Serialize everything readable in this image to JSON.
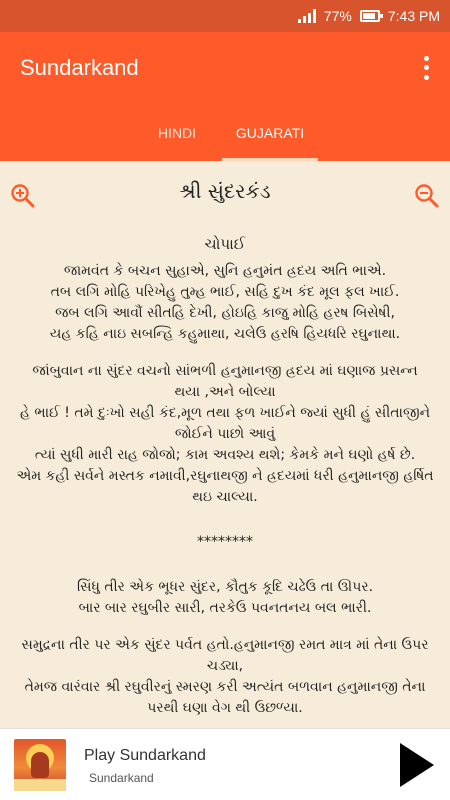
{
  "status_bar": {
    "battery": "77%",
    "time": "7:43 PM"
  },
  "app_bar": {
    "title": "Sundarkand"
  },
  "tabs": [
    {
      "label": "HINDI",
      "active": false
    },
    {
      "label": "GUJARATI",
      "active": true
    }
  ],
  "content": {
    "title": "શ્રી સુંદરકંડ",
    "heading": "ચોપાઈ",
    "lines": [
      "જામવંત કે બચન સુહાએ, સુનિ હનુમંત હ્રદય અતિ ભાએ.",
      "તબ લગિ મોહિ પરિખેહુ તુમ્હ ભાઈ, સહિ દુખ કંદ મૂલ ફલ ખાઈ.",
      "જબ લગિ આવૌં સીતહિ દેખી, હોઇહિ કાજુ મોહિ હરષ બિસેષી,",
      "યહ કહિ નાઇ સબન્હિ કહુમાથા, ચલેઉ હરષિ હિયધરિ રઘુનાથા.",
      "",
      "જાંબુવાન ના સુંદર વચનો સાંભળી હનુમાનજી હ્રદય માં ઘણાજ પ્રસન્ન",
      "થયા ,અને બોલ્યા",
      "હે ભાઈ ! તમે દુઃખો સહી કંદ,મૂળ તથા ફળ ખાઈને જ્યાં સુધી હું સીતાજીને",
      "જોઈને પાછો આવું",
      "ત્યાં સુધી મારી રાહ જોજો; કામ અવશ્ય થશે; કેમકે મને ઘણો હર્ષ છે.",
      "એમ કહી સર્વને મસ્તક નમાવી,રઘુનાથજી ને હ્રદયમાં ધરી હનુમાનજી હર્ષિત",
      "થઇ ચાલ્યા.",
      "",
      "********",
      "",
      "સિંધુ તીર એક ભૂધર સુંદર, કૌતુક કૂદિ ચઢેઉ તા ઊપર.",
      "બાર બાર રઘુબીર સારી, તરકેઉ પવનતનય બલ ભારી.",
      "",
      "સમુદ્રના તીર પર એક સુંદર પર્વત હતો.હનુમાનજી રમત માત્ર માં તેના ઉપર",
      "ચડ્યા,",
      "તેમજ વારંવાર શ્રી રઘુવીરનું સ્મરણ કરી અત્યંત બળવાન હનુમાનજી તેના",
      "પરથી ઘણા વેગ થી ઉછળ્યા."
    ]
  },
  "player": {
    "title": "Play Sundarkand",
    "subtitle": "Sundarkand"
  },
  "colors": {
    "status_bar": "#d8542c",
    "app_bar": "#ff5a2a",
    "content_bg": "#f6ecd9",
    "zoom_icon": "#ff5a2a"
  },
  "icons": {
    "zoom_in": "zoom-in-icon",
    "zoom_out": "zoom-out-icon",
    "menu": "more-vert-icon",
    "play": "play-icon"
  }
}
